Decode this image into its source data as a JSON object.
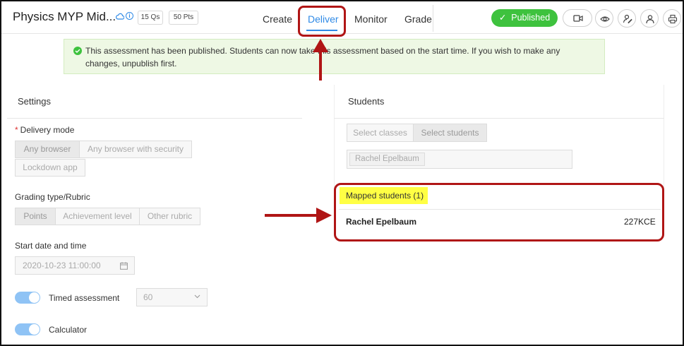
{
  "header": {
    "title": "Physics MYP Mid...",
    "questions_pill": "15 Qs",
    "points_pill": "50 Pts",
    "tabs": [
      {
        "label": "Create"
      },
      {
        "label": "Deliver"
      },
      {
        "label": "Monitor"
      },
      {
        "label": "Grade"
      }
    ],
    "active_tab": "Deliver",
    "published_label": "Published",
    "icons": [
      "cloud-icon",
      "info-icon",
      "video-icon",
      "eye-icon",
      "user-edit-icon",
      "user-icon",
      "print-icon"
    ]
  },
  "banner": {
    "text": "This assessment has been published. Students can now take this assessment based on the start time. If you wish to make any changes, unpublish first."
  },
  "settings": {
    "title": "Settings",
    "delivery_mode": {
      "label": "Delivery mode",
      "required_mark": "*",
      "options": [
        "Any browser",
        "Any browser with security",
        "Lockdown app"
      ],
      "selected": "Any browser"
    },
    "grading": {
      "label": "Grading type/Rubric",
      "options": [
        "Points",
        "Achievement level",
        "Other rubric"
      ],
      "selected": "Points"
    },
    "start": {
      "label": "Start date and time",
      "value": "2020-10-23 11:00:00"
    },
    "timed": {
      "label": "Timed assessment",
      "on": true,
      "minutes": "60"
    },
    "calculator": {
      "label": "Calculator",
      "on": true
    }
  },
  "students": {
    "title": "Students",
    "select_classes": "Select classes",
    "select_students": "Select students",
    "chip": "Rachel Epelbaum",
    "mapped_label": "Mapped students (1)",
    "rows": [
      {
        "name": "Rachel Epelbaum",
        "code": "227KCE"
      }
    ]
  },
  "colors": {
    "accent": "#2f8ae6",
    "published": "#3ec23e",
    "annotation": "#b01515",
    "highlight": "#ffff44",
    "banner_bg": "#eef8e4"
  }
}
